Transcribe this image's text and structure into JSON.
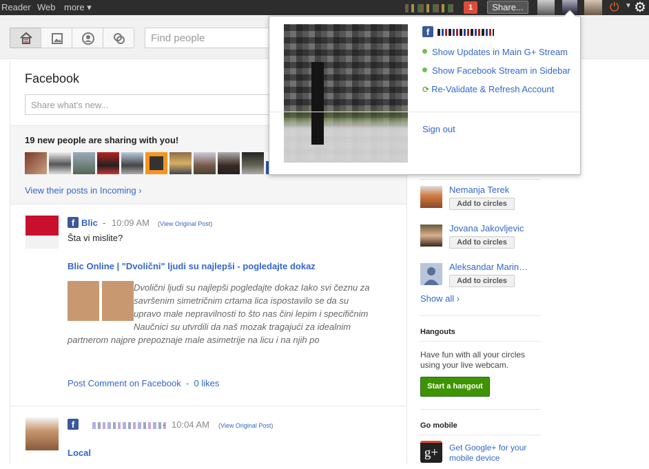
{
  "topbar": {
    "nav": [
      "Reader",
      "Web",
      "more ▾"
    ],
    "notification_count": "1",
    "share_label": "Share..."
  },
  "toolbar": {
    "find_people_placeholder": "Find people"
  },
  "stream": {
    "heading": "Facebook",
    "share_placeholder": "Share what's new...",
    "incoming": {
      "title": "19 new people are sharing with you!",
      "link": "View their posts in Incoming ›"
    },
    "posts": [
      {
        "source_icon": "facebook-icon",
        "author": "Blic",
        "time": "10:09 AM",
        "view_original": "View Original Post",
        "text": "Šta vi mislite?",
        "link_title": "Blic Online | \"Dvolični\" ljudi su najlepši - pogledajte dokaz",
        "excerpt": "Dvolični ljudi su najlepši pogledajte dokaz Iako svi čeznu za savršenim simetričnim crtama lica ispostavilo se da su upravo male nepravilnosti to što nas čini lepim i specifičnim Naučnici su utvrdili da naš mozak tragajući za idealnim partnerom najpre prepoznaje male asimetrije na licu i na njih po",
        "comment_link": "Post Comment on Facebook",
        "likes": "0 likes"
      },
      {
        "source_icon": "facebook-icon",
        "time": "10:04 AM",
        "view_original": "View Original Post",
        "title": "Local"
      }
    ]
  },
  "sidebar": {
    "suggestions": [
      {
        "name": "Nemanja Terek",
        "button": "Add to circles"
      },
      {
        "name": "Jovana Jakovljevic",
        "button": "Add to circles"
      },
      {
        "name": "Aleksandar Marin…",
        "button": "Add to circles"
      }
    ],
    "show_all": "Show all ›",
    "hangouts": {
      "title": "Hangouts",
      "text": "Have fun with all your circles using your live webcam.",
      "button": "Start a hangout"
    },
    "mobile": {
      "title": "Go mobile",
      "link": "Get Google+ for your mobile device"
    }
  },
  "popup": {
    "items": [
      "Show Updates in Main G+ Stream",
      "Show Facebook Stream in Sidebar",
      "Re-Validate & Refresh Account"
    ],
    "sign_out": "Sign out"
  },
  "colors": {
    "link": "#3366cc",
    "facebook": "#3b5998",
    "hangout_green": "#3d9400",
    "notification_red": "#dd4b39"
  }
}
